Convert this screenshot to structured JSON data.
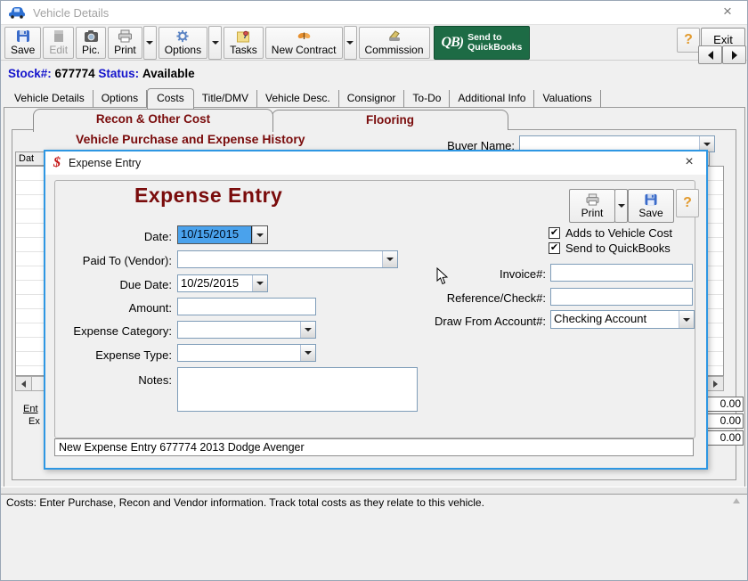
{
  "window": {
    "title": "Vehicle Details",
    "close_glyph": "×"
  },
  "toolbar": {
    "save": "Save",
    "edit": "Edit",
    "pic": "Pic.",
    "print": "Print",
    "options": "Options",
    "tasks": "Tasks",
    "new_contract": "New Contract",
    "commission": "Commission",
    "qb_logo": "QB)",
    "qb_line1": "Send to",
    "qb_line2": "QuickBooks",
    "help": "?",
    "exit": "Exit"
  },
  "header": {
    "stock_label": "Stock#:",
    "stock_value": "677774",
    "status_label": "Status:",
    "status_value": "Available"
  },
  "tabs": {
    "items": [
      "Vehicle Details",
      "Options",
      "Costs",
      "Title/DMV",
      "Vehicle Desc.",
      "Consignor",
      "To-Do",
      "Additional Info",
      "Valuations"
    ],
    "active": "Costs"
  },
  "subtabs": {
    "recon": "Recon & Other Cost",
    "flooring": "Flooring"
  },
  "costs_panel": {
    "heading": "Vehicle Purchase and Expense History",
    "buyer_name_label": "Buyer Name:",
    "buyer_name_value": "",
    "grid_header": "Dat",
    "enter_expense_line1": "Ent",
    "enter_expense_line2": "Ex",
    "totals": [
      "0.00",
      "0.00",
      "0.00"
    ]
  },
  "status_bar": {
    "text": "Costs: Enter Purchase, Recon and Vendor information. Track total costs as they relate to this vehicle."
  },
  "dialog": {
    "title": "Expense Entry",
    "dollar_glyph": "$",
    "close_glyph": "×",
    "heading": "Expense Entry",
    "print": "Print",
    "save": "Save",
    "help": "?",
    "checkboxes": {
      "vehicle_cost": "Adds to Vehicle Cost",
      "quickbooks": "Send to QuickBooks"
    },
    "fields": {
      "date_label": "Date:",
      "date_value": "10/15/2015",
      "paid_to_label": "Paid To (Vendor):",
      "paid_to_value": "",
      "due_date_label": "Due Date:",
      "due_date_value": "10/25/2015",
      "amount_label": "Amount:",
      "amount_value": "",
      "expense_category_label": "Expense Category:",
      "expense_category_value": "",
      "expense_type_label": "Expense Type:",
      "expense_type_value": "",
      "notes_label": "Notes:",
      "notes_value": "",
      "invoice_label": "Invoice#:",
      "invoice_value": "",
      "reference_label": "Reference/Check#:",
      "reference_value": "",
      "draw_account_label": "Draw From Account#:",
      "draw_account_value": "Checking Account"
    },
    "status_text": "New Expense Entry 677774 2013 Dodge Avenger"
  }
}
